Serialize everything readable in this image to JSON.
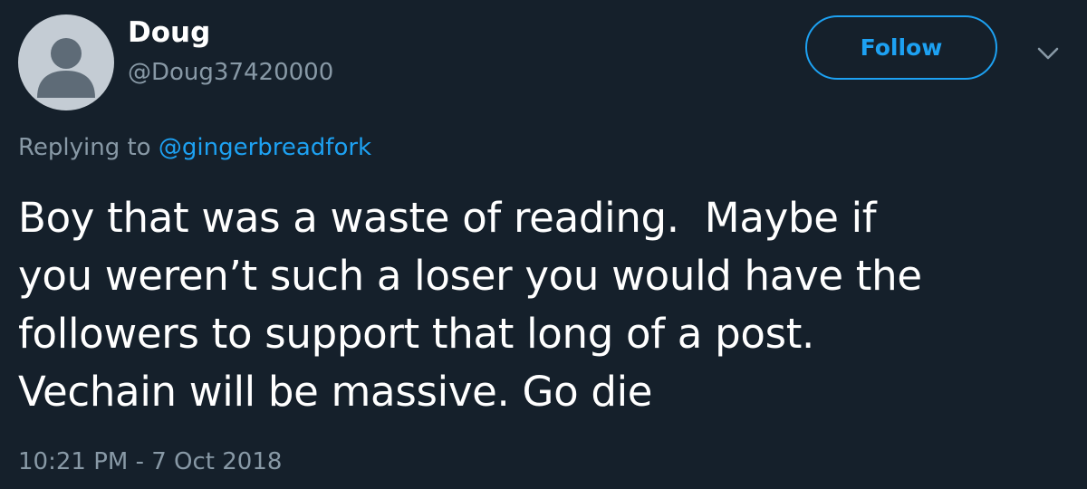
{
  "tweet": {
    "author": {
      "display_name": "Doug",
      "handle": "@Doug37420000",
      "avatar_icon": "default-profile-silhouette-icon"
    },
    "follow_label": "Follow",
    "menu_icon": "chevron-down-icon",
    "reply_context": {
      "prefix": "Replying to ",
      "mention": "@gingerbreadfork"
    },
    "text_lines": [
      "Boy that was a waste of reading.  Maybe if",
      "you weren’t such a loser you would have the",
      "followers to support that long of a post.",
      "Vechain will be massive. Go die"
    ],
    "timestamp": "10:21 PM - 7 Oct 2018"
  },
  "colors": {
    "background": "#15202b",
    "text_primary": "#ffffff",
    "text_secondary": "#8899a6",
    "accent": "#1da1f2",
    "avatar_bg": "#c4ccd4",
    "avatar_figure": "#5e6b77"
  }
}
